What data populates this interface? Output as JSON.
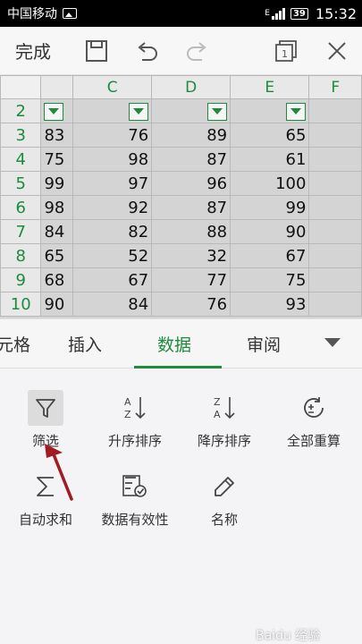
{
  "status_bar": {
    "carrier": "中国移动",
    "network": "E",
    "battery": "39",
    "time": "15:32"
  },
  "toolbar": {
    "done_label": "完成"
  },
  "sheet": {
    "col_headers": [
      "C",
      "D",
      "E",
      "F"
    ],
    "rows": [
      {
        "num": "2",
        "filter": true,
        "cells": [
          "",
          "",
          "",
          ""
        ]
      },
      {
        "num": "3",
        "cells": [
          "83",
          "76",
          "89",
          "65"
        ]
      },
      {
        "num": "4",
        "cells": [
          "75",
          "98",
          "87",
          "61"
        ]
      },
      {
        "num": "5",
        "cells": [
          "99",
          "97",
          "96",
          "100"
        ]
      },
      {
        "num": "6",
        "cells": [
          "98",
          "92",
          "87",
          "99"
        ]
      },
      {
        "num": "7",
        "cells": [
          "84",
          "82",
          "88",
          "90"
        ]
      },
      {
        "num": "8",
        "cells": [
          "65",
          "52",
          "32",
          "67"
        ]
      },
      {
        "num": "9",
        "cells": [
          "68",
          "67",
          "77",
          "75"
        ]
      },
      {
        "num": "10",
        "cells": [
          "90",
          "84",
          "76",
          "93"
        ]
      }
    ]
  },
  "tabs": [
    {
      "label": "元格",
      "active": false
    },
    {
      "label": "插入",
      "active": false
    },
    {
      "label": "数据",
      "active": true
    },
    {
      "label": "审阅",
      "active": false
    }
  ],
  "tools": [
    {
      "label": "筛选",
      "icon": "filter-icon",
      "selected": true
    },
    {
      "label": "升序排序",
      "icon": "sort-ascending-icon"
    },
    {
      "label": "降序排序",
      "icon": "sort-descending-icon"
    },
    {
      "label": "全部重算",
      "icon": "recalculate-icon"
    },
    {
      "label": "自动求和",
      "icon": "sigma-icon"
    },
    {
      "label": "数据有效性",
      "icon": "data-validation-icon"
    },
    {
      "label": "名称",
      "icon": "tag-icon"
    }
  ],
  "colors": {
    "accent": "#1e8a3d",
    "annotation_arrow": "#a01b22"
  },
  "watermark": "Baidu 经验"
}
